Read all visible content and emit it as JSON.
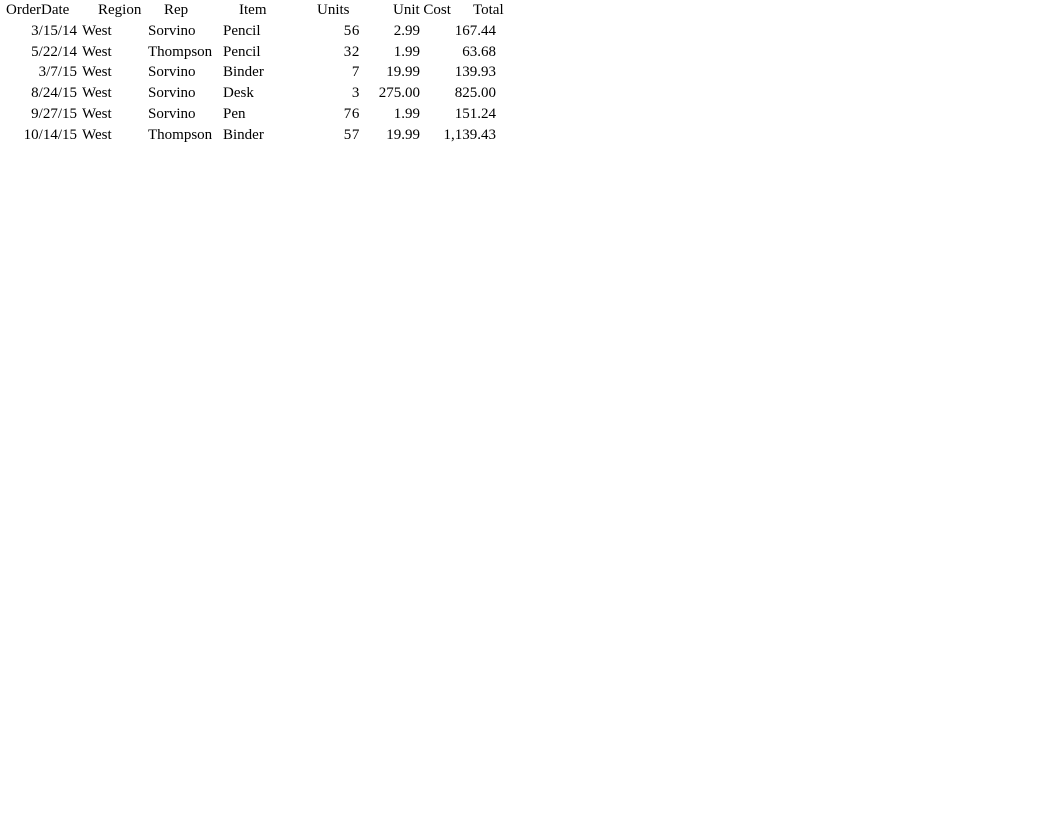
{
  "table": {
    "name": "order-records",
    "columns": [
      {
        "key": "orderdate",
        "label": "OrderDate",
        "align": "right"
      },
      {
        "key": "region",
        "label": "Region",
        "align": "left"
      },
      {
        "key": "rep",
        "label": "Rep",
        "align": "left"
      },
      {
        "key": "item",
        "label": "Item",
        "align": "left"
      },
      {
        "key": "units",
        "label": "Units",
        "align": "right"
      },
      {
        "key": "unitcost",
        "label": "Unit Cost",
        "align": "right"
      },
      {
        "key": "total",
        "label": "Total",
        "align": "right"
      }
    ],
    "headers": {
      "orderdate": "OrderDate",
      "region": "Region",
      "rep": "Rep",
      "item": "Item",
      "units": "Units",
      "unitcost": "Unit Cost",
      "total": "Total"
    },
    "rows": [
      {
        "orderdate": "3/15/14",
        "region": "West",
        "rep": "Sorvino",
        "item": "Pencil",
        "units": "56",
        "unitcost": "2.99",
        "total": "167.44"
      },
      {
        "orderdate": "5/22/14",
        "region": "West",
        "rep": "Thompson",
        "item": "Pencil",
        "units": "32",
        "unitcost": "1.99",
        "total": "63.68"
      },
      {
        "orderdate": "3/7/15",
        "region": "West",
        "rep": "Sorvino",
        "item": "Binder",
        "units": "7",
        "unitcost": "19.99",
        "total": "139.93"
      },
      {
        "orderdate": "8/24/15",
        "region": "West",
        "rep": "Sorvino",
        "item": "Desk",
        "units": "3",
        "unitcost": "275.00",
        "total": "825.00"
      },
      {
        "orderdate": "9/27/15",
        "region": "West",
        "rep": "Sorvino",
        "item": "Pen",
        "units": "76",
        "unitcost": "1.99",
        "total": "151.24"
      },
      {
        "orderdate": "10/14/15",
        "region": "West",
        "rep": "Thompson",
        "item": "Binder",
        "units": "57",
        "unitcost": "19.99",
        "total": "1,139.43"
      }
    ]
  },
  "colors": {
    "page_background": "#ffffff",
    "text": "#000000"
  }
}
